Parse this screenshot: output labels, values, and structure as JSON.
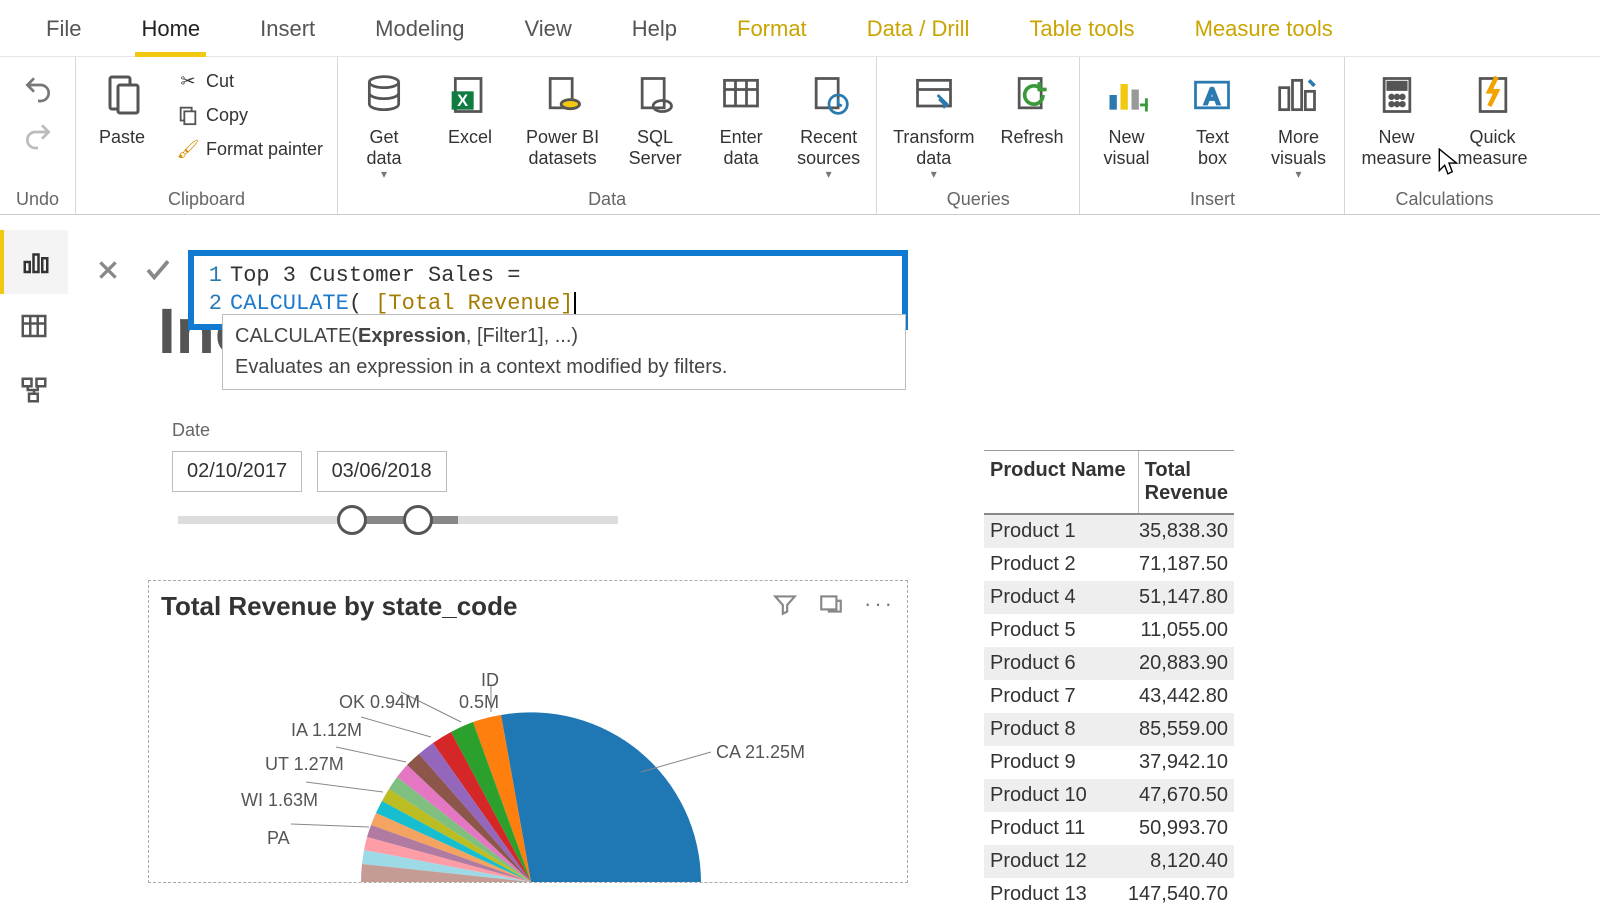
{
  "ribbon": {
    "tabs": [
      "File",
      "Home",
      "Insert",
      "Modeling",
      "View",
      "Help",
      "Format",
      "Data / Drill",
      "Table tools",
      "Measure tools"
    ],
    "active_tab": "Home",
    "context_tabs": [
      "Format",
      "Data / Drill",
      "Table tools",
      "Measure tools"
    ],
    "groups": {
      "undo": {
        "undo": "Undo"
      },
      "clipboard": {
        "paste": "Paste",
        "cut": "Cut",
        "copy": "Copy",
        "format_painter": "Format painter",
        "label": "Clipboard"
      },
      "data": {
        "get_data": "Get\ndata",
        "excel": "Excel",
        "pbi_ds": "Power BI\ndatasets",
        "sql": "SQL\nServer",
        "enter": "Enter\ndata",
        "recent": "Recent\nsources",
        "label": "Data"
      },
      "queries": {
        "transform": "Transform\ndata",
        "refresh": "Refresh",
        "label": "Queries"
      },
      "insert": {
        "new_visual": "New\nvisual",
        "text_box": "Text\nbox",
        "more_visuals": "More\nvisuals",
        "label": "Insert"
      },
      "calculations": {
        "new_measure": "New\nmeasure",
        "quick_measure": "Quick\nmeasure",
        "label": "Calculations"
      }
    }
  },
  "formula": {
    "line1_num": "1",
    "line1_text": "Top 3 Customer Sales =",
    "line2_num": "2",
    "line2_func": "CALCULATE",
    "line2_paren": "( ",
    "line2_ref": "[Total Revenue]",
    "tooltip_sig_pre": "CALCULATE(",
    "tooltip_sig_bold": "Expression",
    "tooltip_sig_post": ", [Filter1], ...)",
    "tooltip_desc": "Evaluates an expression in a context modified by filters."
  },
  "behind_title": "Inc",
  "slicer": {
    "label": "Date",
    "from": "02/10/2017",
    "to": "03/06/2018"
  },
  "pie": {
    "title": "Total Revenue by state_code",
    "labels": {
      "ca": "CA 21.25M",
      "id": "ID",
      "ok_val": "0.5M",
      "ok": "OK 0.94M",
      "ia": "IA 1.12M",
      "ut": "UT 1.27M",
      "wi": "WI 1.63M",
      "pa": "PA"
    }
  },
  "table": {
    "headers": {
      "c1": "Product Name",
      "c2": "Total Revenue"
    },
    "rows": [
      {
        "c1": "Product 1",
        "c2": "35,838.30"
      },
      {
        "c1": "Product 2",
        "c2": "71,187.50"
      },
      {
        "c1": "Product 4",
        "c2": "51,147.80"
      },
      {
        "c1": "Product 5",
        "c2": "11,055.00"
      },
      {
        "c1": "Product 6",
        "c2": "20,883.90"
      },
      {
        "c1": "Product 7",
        "c2": "43,442.80"
      },
      {
        "c1": "Product 8",
        "c2": "85,559.00"
      },
      {
        "c1": "Product 9",
        "c2": "37,942.10"
      },
      {
        "c1": "Product 10",
        "c2": "47,670.50"
      },
      {
        "c1": "Product 11",
        "c2": "50,993.70"
      },
      {
        "c1": "Product 12",
        "c2": "8,120.40"
      },
      {
        "c1": "Product 13",
        "c2": "147,540.70"
      }
    ]
  },
  "chart_data": {
    "type": "pie",
    "title": "Total Revenue by state_code",
    "series": [
      {
        "name": "Total Revenue",
        "values": [
          21.25,
          1.63,
          1.27,
          1.12,
          0.94,
          0.5
        ]
      }
    ],
    "categories": [
      "CA",
      "WI",
      "UT",
      "IA",
      "OK",
      "ID"
    ],
    "unit": "M",
    "note": "Additional small slices visible but unlabeled; PA label visible without value (cut off)."
  }
}
